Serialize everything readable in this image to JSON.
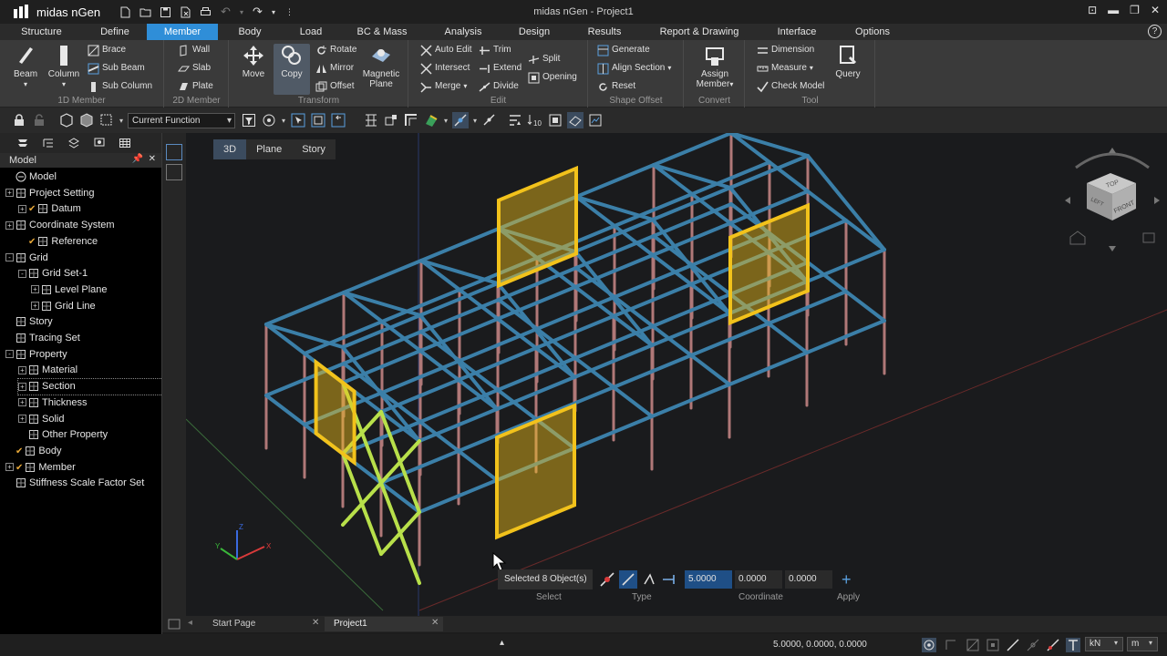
{
  "titlebar": {
    "app_name": "midas nGen",
    "window_title": "midas nGen - Project1"
  },
  "menus": [
    "Structure",
    "Define",
    "Member",
    "Body",
    "Load",
    "BC & Mass",
    "Analysis",
    "Design",
    "Results",
    "Report & Drawing",
    "Interface",
    "Options"
  ],
  "active_menu": "Member",
  "ribbon": {
    "member_1d": {
      "beam": "Beam",
      "column": "Column",
      "brace": "Brace",
      "sub_beam": "Sub Beam",
      "sub_column": "Sub Column",
      "label": "1D Member"
    },
    "member_2d": {
      "wall": "Wall",
      "slab": "Slab",
      "plate": "Plate",
      "label": "2D Member"
    },
    "transform": {
      "move": "Move",
      "copy": "Copy",
      "rotate": "Rotate",
      "mirror": "Mirror",
      "offset": "Offset",
      "magnetic": "Magnetic",
      "plane": "Plane",
      "label": "Transform"
    },
    "edit": {
      "auto_edit": "Auto Edit",
      "trim": "Trim",
      "intersect": "Intersect",
      "extend": "Extend",
      "split": "Split",
      "merge": "Merge",
      "divide": "Divide",
      "opening": "Opening",
      "label": "Edit"
    },
    "shape_offset": {
      "generate": "Generate",
      "align_section": "Align Section",
      "reset": "Reset",
      "label": "Shape Offset"
    },
    "convert": {
      "assign": "Assign",
      "member": "Member",
      "label": "Convert"
    },
    "tool": {
      "dimension": "Dimension",
      "measure": "Measure",
      "check_model": "Check Model",
      "query": "Query",
      "label": "Tool"
    }
  },
  "toolbar": {
    "function_select": "Current Function"
  },
  "model_panel": {
    "title": "Model",
    "tree": [
      {
        "label": "Model"
      },
      {
        "label": "Project Setting"
      },
      {
        "label": "Datum"
      },
      {
        "label": "Coordinate System"
      },
      {
        "label": "Reference"
      },
      {
        "label": "Grid"
      },
      {
        "label": "Grid Set-1"
      },
      {
        "label": "Level Plane"
      },
      {
        "label": "Grid Line"
      },
      {
        "label": "Story"
      },
      {
        "label": "Tracing Set"
      },
      {
        "label": "Property"
      },
      {
        "label": "Material"
      },
      {
        "label": "Section"
      },
      {
        "label": "Thickness"
      },
      {
        "label": "Solid"
      },
      {
        "label": "Other Property"
      },
      {
        "label": "Body"
      },
      {
        "label": "Member"
      },
      {
        "label": "Stiffness Scale Factor Set"
      }
    ]
  },
  "view_tabs": [
    "3D",
    "Plane",
    "Story"
  ],
  "active_view_tab": "3D",
  "viewcube": {
    "top": "TOP",
    "front": "FRONT",
    "left": "LEFT"
  },
  "inputbar": {
    "selection": "Selected 8 Object(s)",
    "values": [
      "5.0000",
      "0.0000",
      "0.0000"
    ],
    "labels": {
      "select": "Select",
      "type": "Type",
      "coordinate": "Coordinate",
      "apply": "Apply"
    }
  },
  "doc_tabs": [
    "Start Page",
    "Project1"
  ],
  "active_doc_tab": "Project1",
  "status": {
    "coordinates": "5.0000, 0.0000, 0.0000",
    "force_unit": "kN",
    "length_unit": "m"
  },
  "colors": {
    "accent": "#2f8ed8",
    "beam": "#3b7fa8",
    "column": "#b07878",
    "selected": "#f2c21b",
    "brace_selected": "#b8e04a"
  }
}
